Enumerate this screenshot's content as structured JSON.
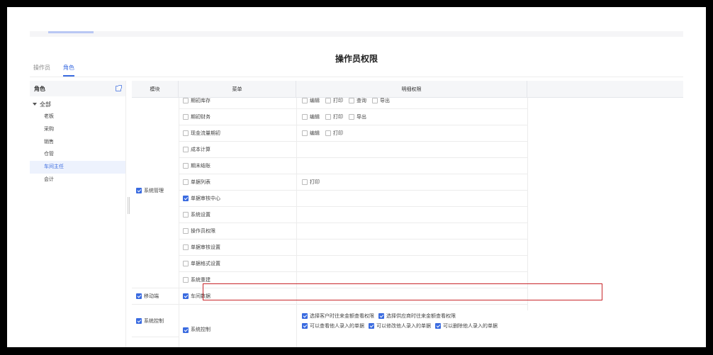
{
  "page": {
    "title": "操作员权限"
  },
  "tabs": [
    {
      "label": "操作员",
      "active": false
    },
    {
      "label": "角色",
      "active": true
    }
  ],
  "sidebar": {
    "header": "角色",
    "root": "全部",
    "items": [
      {
        "label": "老板",
        "selected": false
      },
      {
        "label": "采购",
        "selected": false
      },
      {
        "label": "销售",
        "selected": false
      },
      {
        "label": "仓管",
        "selected": false
      },
      {
        "label": "车间主任",
        "selected": true
      },
      {
        "label": "会计",
        "selected": false
      }
    ]
  },
  "table": {
    "headers": {
      "module": "模块",
      "menu": "菜单",
      "detail": "明细权限"
    },
    "rows": [
      {
        "menu": "期初库存",
        "checked": false,
        "perms": [
          {
            "label": "编辑",
            "checked": false
          },
          {
            "label": "打印",
            "checked": false
          },
          {
            "label": "查询",
            "checked": false
          },
          {
            "label": "导出",
            "checked": false
          }
        ]
      },
      {
        "menu": "期初财务",
        "checked": false,
        "perms": [
          {
            "label": "编辑",
            "checked": false
          },
          {
            "label": "打印",
            "checked": false
          },
          {
            "label": "导出",
            "checked": false
          }
        ]
      },
      {
        "menu": "现金流量期初",
        "checked": false,
        "perms": [
          {
            "label": "编辑",
            "checked": false
          },
          {
            "label": "打印",
            "checked": false
          }
        ]
      },
      {
        "menu": "成本计算",
        "checked": false,
        "perms": []
      },
      {
        "menu": "期末结账",
        "checked": false,
        "perms": []
      },
      {
        "menu": "单据列表",
        "checked": false,
        "perms": [
          {
            "label": "打印",
            "checked": false
          }
        ]
      },
      {
        "menu": "单据审核中心",
        "checked": true,
        "perms": []
      },
      {
        "menu": "系统设置",
        "checked": false,
        "perms": []
      },
      {
        "menu": "操作员权限",
        "checked": false,
        "perms": []
      },
      {
        "menu": "单据审核设置",
        "checked": false,
        "perms": []
      },
      {
        "menu": "单据格式设置",
        "checked": false,
        "perms": []
      },
      {
        "menu": "系统重建",
        "checked": false,
        "perms": []
      },
      {
        "menu": "车间数据",
        "checked": true,
        "perms": []
      }
    ],
    "modules": [
      {
        "label": "系统管理",
        "checked": true
      },
      {
        "label": "移动端",
        "checked": true
      },
      {
        "label": "系统控制",
        "checked": true
      }
    ],
    "system_control": {
      "menu": "系统控制",
      "checked": true,
      "perm_lines": [
        [
          {
            "label": "选择客户时往来金额查看权限",
            "checked": true
          },
          {
            "label": "选择供应商时往来金额查看权限",
            "checked": true
          }
        ],
        [
          {
            "label": "可以查看他人录入的单据",
            "checked": true
          },
          {
            "label": "可以修改他人录入的单据",
            "checked": true
          },
          {
            "label": "可以删除他人录入的单据",
            "checked": true
          }
        ]
      ]
    }
  },
  "colors": {
    "accent": "#3a6be0",
    "highlight": "#c8262b"
  }
}
